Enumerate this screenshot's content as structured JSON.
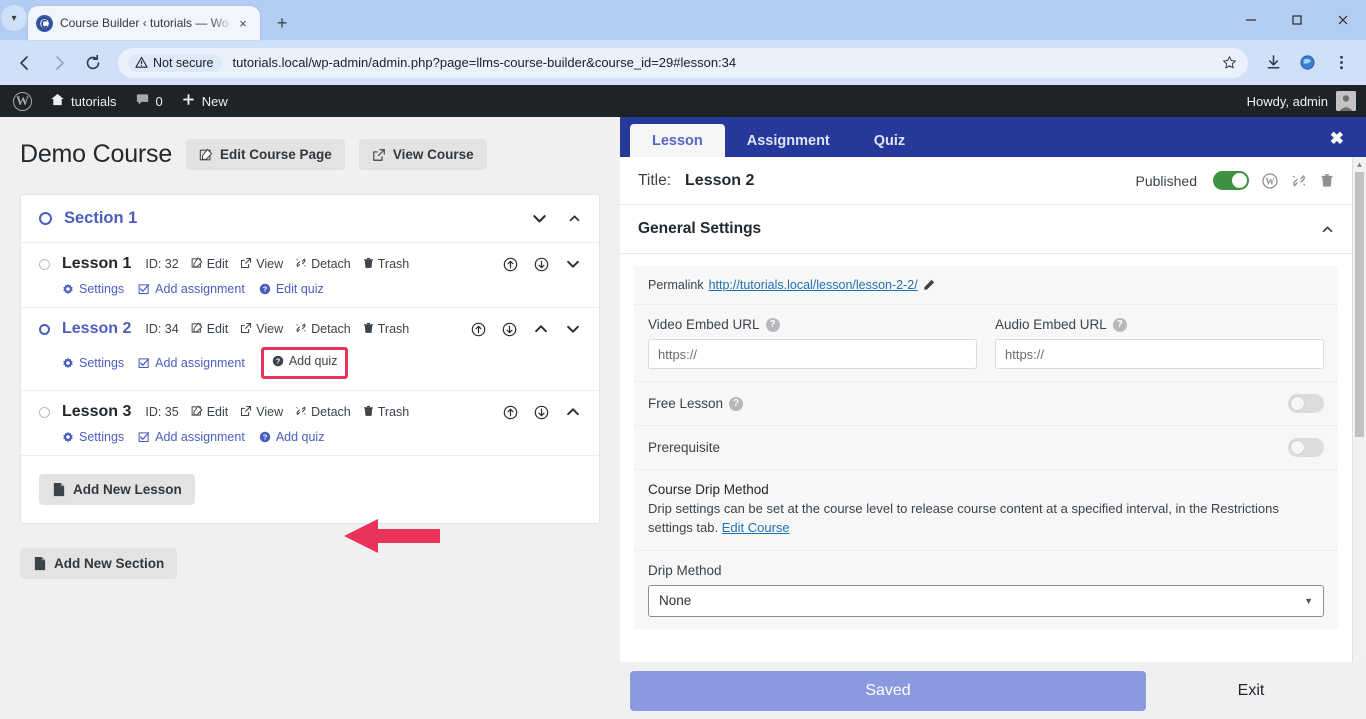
{
  "browser": {
    "tab": {
      "title": "Course Builder ‹ tutorials — Wo",
      "favicon": "wordpress-icon",
      "close": "×"
    },
    "new_tab_label": "+",
    "security_label": "Not secure",
    "url": "tutorials.local/wp-admin/admin.php?page=llms-course-builder&course_id=29#lesson:34",
    "window": {
      "minimize": "minimize-icon",
      "maximize": "maximize-icon",
      "close": "close-icon"
    },
    "toolbar_icons": [
      "back-icon",
      "forward-icon",
      "reload-icon",
      "bookmark-star-icon",
      "download-icon",
      "extension-icon",
      "menu-icon"
    ]
  },
  "adminbar": {
    "logo": "W",
    "site_name": "tutorials",
    "comments_count": "0",
    "new_label": "New",
    "howdy": "Howdy, admin"
  },
  "course": {
    "title": "Demo Course",
    "edit_page_btn": "Edit Course Page",
    "view_course_btn": "View Course",
    "add_new_section_btn": "Add New Section",
    "add_new_lesson_btn": "Add New Lesson"
  },
  "section": {
    "title": "Section 1"
  },
  "lessons": [
    {
      "name": "Lesson 1",
      "id_label": "ID: 32",
      "edit": "Edit",
      "view": "View",
      "detach": "Detach",
      "trash": "Trash",
      "settings": "Settings",
      "add_assignment": "Add assignment",
      "quiz": "Edit quiz",
      "selected": false,
      "highlighted": false
    },
    {
      "name": "Lesson 2",
      "id_label": "ID: 34",
      "edit": "Edit",
      "view": "View",
      "detach": "Detach",
      "trash": "Trash",
      "settings": "Settings",
      "add_assignment": "Add assignment",
      "quiz": "Add quiz",
      "selected": true,
      "highlighted": true
    },
    {
      "name": "Lesson 3",
      "id_label": "ID: 35",
      "edit": "Edit",
      "view": "View",
      "detach": "Detach",
      "trash": "Trash",
      "settings": "Settings",
      "add_assignment": "Add assignment",
      "quiz": "Add quiz",
      "selected": false,
      "highlighted": false
    }
  ],
  "panel": {
    "tabs": [
      {
        "label": "Lesson",
        "active": true
      },
      {
        "label": "Assignment",
        "active": false
      },
      {
        "label": "Quiz",
        "active": false
      }
    ],
    "close_label": "✖",
    "title_label": "Title:",
    "title_value": "Lesson 2",
    "published_label": "Published",
    "published_on": true,
    "title_icons": [
      "wordpress-icon",
      "detach-icon",
      "trash-icon"
    ],
    "general_settings": {
      "heading": "General Settings",
      "permalink_label": "Permalink",
      "permalink_url": "http://tutorials.local/lesson/lesson-2-2/",
      "video_label": "Video Embed URL",
      "video_placeholder": "https://",
      "video_value": "",
      "audio_label": "Audio Embed URL",
      "audio_placeholder": "https://",
      "audio_value": "",
      "free_lesson_label": "Free Lesson",
      "free_lesson_on": false,
      "prerequisite_label": "Prerequisite",
      "prerequisite_on": false,
      "drip_title": "Course Drip Method",
      "drip_desc_1": "Drip settings can be set at the course level to release course content at a specified interval, in the Restrictions settings tab.",
      "drip_desc_link": "Edit Course",
      "drip_method_label": "Drip Method",
      "drip_method_value": "None"
    }
  },
  "footer": {
    "saved_label": "Saved",
    "exit_label": "Exit"
  },
  "colors": {
    "accent_blue": "#4b5ec0",
    "tabbar_navy": "#24399a",
    "highlight_red": "#e8335a",
    "toggle_green": "#3f9142",
    "saved_button": "#8b9ae0",
    "adminbar": "#1d2327"
  }
}
